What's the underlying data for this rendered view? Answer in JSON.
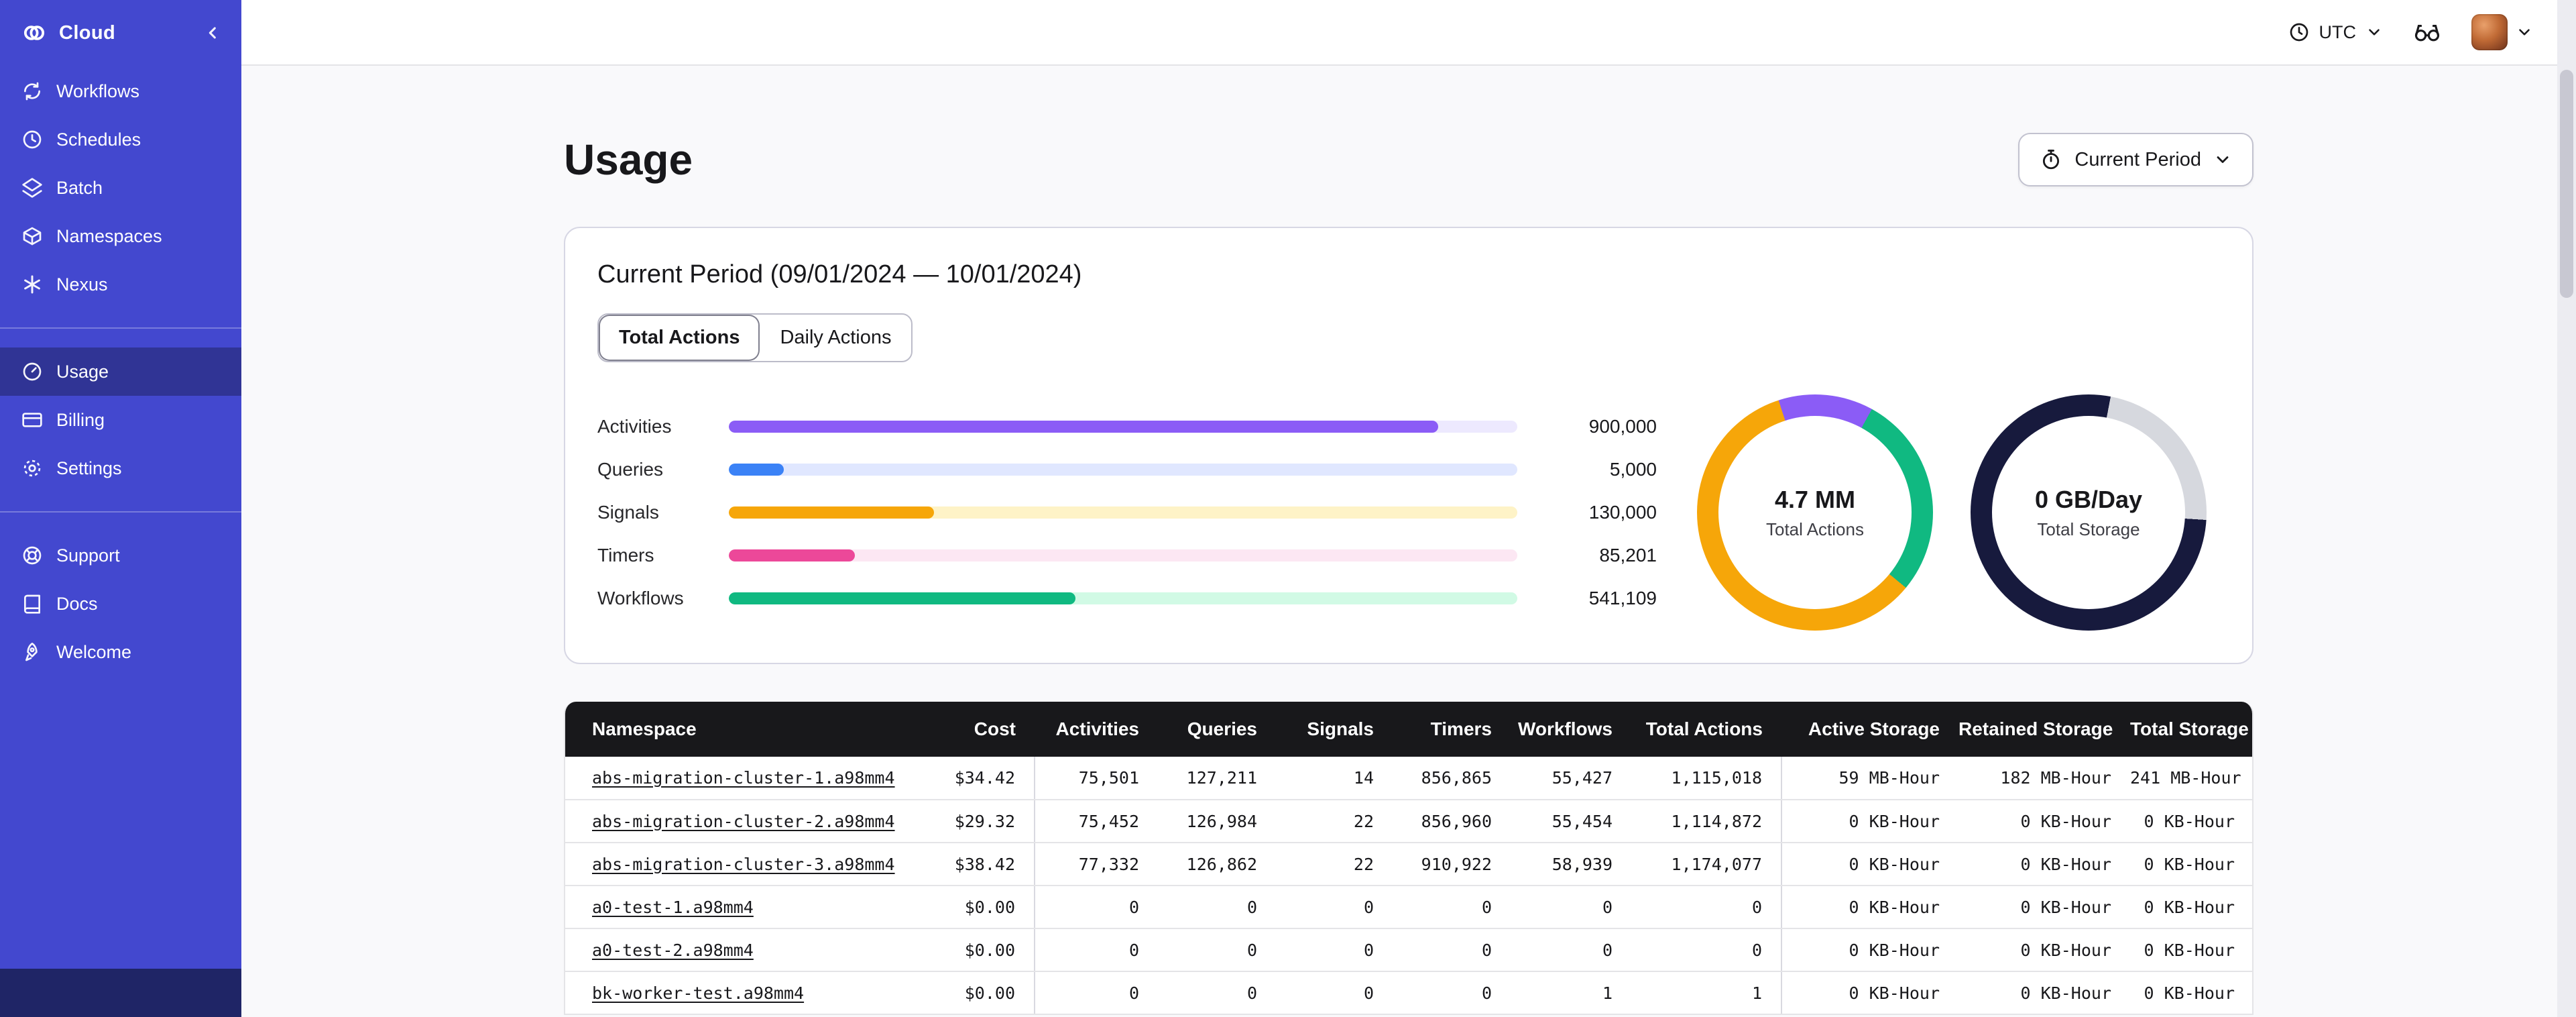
{
  "colors": {
    "sidebar_bg": "#4348CF",
    "sidebar_active": "rgba(0,0,0,0.28)",
    "sidebar_footer": "#1F2566",
    "table_header_bg": "#18181b"
  },
  "brand": {
    "name": "Cloud"
  },
  "topbar": {
    "timezone": "UTC"
  },
  "sidebar": {
    "groups": [
      {
        "items": [
          {
            "label": "Workflows"
          },
          {
            "label": "Schedules"
          },
          {
            "label": "Batch"
          },
          {
            "label": "Namespaces"
          },
          {
            "label": "Nexus"
          }
        ]
      },
      {
        "items": [
          {
            "label": "Usage",
            "active": true
          },
          {
            "label": "Billing"
          },
          {
            "label": "Settings"
          }
        ]
      },
      {
        "items": [
          {
            "label": "Support"
          },
          {
            "label": "Docs"
          },
          {
            "label": "Welcome"
          }
        ]
      }
    ]
  },
  "page": {
    "title": "Usage",
    "period_selector": "Current Period"
  },
  "card": {
    "title": "Current Period (09/01/2024 — 10/01/2024)",
    "tabs": [
      {
        "label": "Total Actions",
        "active": true
      },
      {
        "label": "Daily Actions",
        "active": false
      }
    ]
  },
  "chart_data": [
    {
      "type": "bar",
      "orientation": "horizontal",
      "categories": [
        "Activities",
        "Queries",
        "Signals",
        "Timers",
        "Workflows"
      ],
      "values": [
        900000,
        5000,
        130000,
        85201,
        541109
      ],
      "value_labels": [
        "900,000",
        "5,000",
        "130,000",
        "85,201",
        "541,109"
      ],
      "fill_pct": [
        90,
        7,
        26,
        16,
        44
      ],
      "colors": [
        "#8b5cf6",
        "#3b82f6",
        "#f6a609",
        "#ec4899",
        "#10b981"
      ],
      "track_colors": [
        "#ede9fe",
        "#e0e7ff",
        "#fef3c7",
        "#fce7f3",
        "#d1fae5"
      ]
    },
    {
      "type": "pie",
      "subtype": "donut",
      "label": "4.7 MM",
      "sublabel": "Total Actions",
      "start_deg": -18,
      "segments": [
        {
          "name": "purple",
          "pct": 13,
          "color": "#8b5cf6"
        },
        {
          "name": "green",
          "pct": 28,
          "color": "#10b981"
        },
        {
          "name": "orange",
          "pct": 59,
          "color": "#f6a609"
        }
      ]
    },
    {
      "type": "pie",
      "subtype": "donut",
      "label": "0 GB/Day",
      "sublabel": "Total Storage",
      "start_deg": 0,
      "segments": [
        {
          "name": "dark",
          "pct": 3,
          "color": "#171a3d"
        },
        {
          "name": "gray",
          "pct": 23,
          "color": "#d6d8de"
        },
        {
          "name": "dark2",
          "pct": 74,
          "color": "#171a3d"
        }
      ]
    }
  ],
  "table": {
    "columns": [
      "Namespace",
      "Cost",
      "Activities",
      "Queries",
      "Signals",
      "Timers",
      "Workflows",
      "Total Actions",
      "Active Storage",
      "Retained Storage",
      "Total Storage"
    ],
    "rows": [
      [
        "abs-migration-cluster-1.a98mm4",
        "$34.42",
        "75,501",
        "127,211",
        "14",
        "856,865",
        "55,427",
        "1,115,018",
        "59 MB-Hour",
        "182 MB-Hour",
        "241 MB-Hour"
      ],
      [
        "abs-migration-cluster-2.a98mm4",
        "$29.32",
        "75,452",
        "126,984",
        "22",
        "856,960",
        "55,454",
        "1,114,872",
        "0 KB-Hour",
        "0 KB-Hour",
        "0 KB-Hour"
      ],
      [
        "abs-migration-cluster-3.a98mm4",
        "$38.42",
        "77,332",
        "126,862",
        "22",
        "910,922",
        "58,939",
        "1,174,077",
        "0 KB-Hour",
        "0 KB-Hour",
        "0 KB-Hour"
      ],
      [
        "a0-test-1.a98mm4",
        "$0.00",
        "0",
        "0",
        "0",
        "0",
        "0",
        "0",
        "0 KB-Hour",
        "0 KB-Hour",
        "0 KB-Hour"
      ],
      [
        "a0-test-2.a98mm4",
        "$0.00",
        "0",
        "0",
        "0",
        "0",
        "0",
        "0",
        "0 KB-Hour",
        "0 KB-Hour",
        "0 KB-Hour"
      ],
      [
        "bk-worker-test.a98mm4",
        "$0.00",
        "0",
        "0",
        "0",
        "0",
        "1",
        "1",
        "0 KB-Hour",
        "0 KB-Hour",
        "0 KB-Hour"
      ]
    ]
  }
}
